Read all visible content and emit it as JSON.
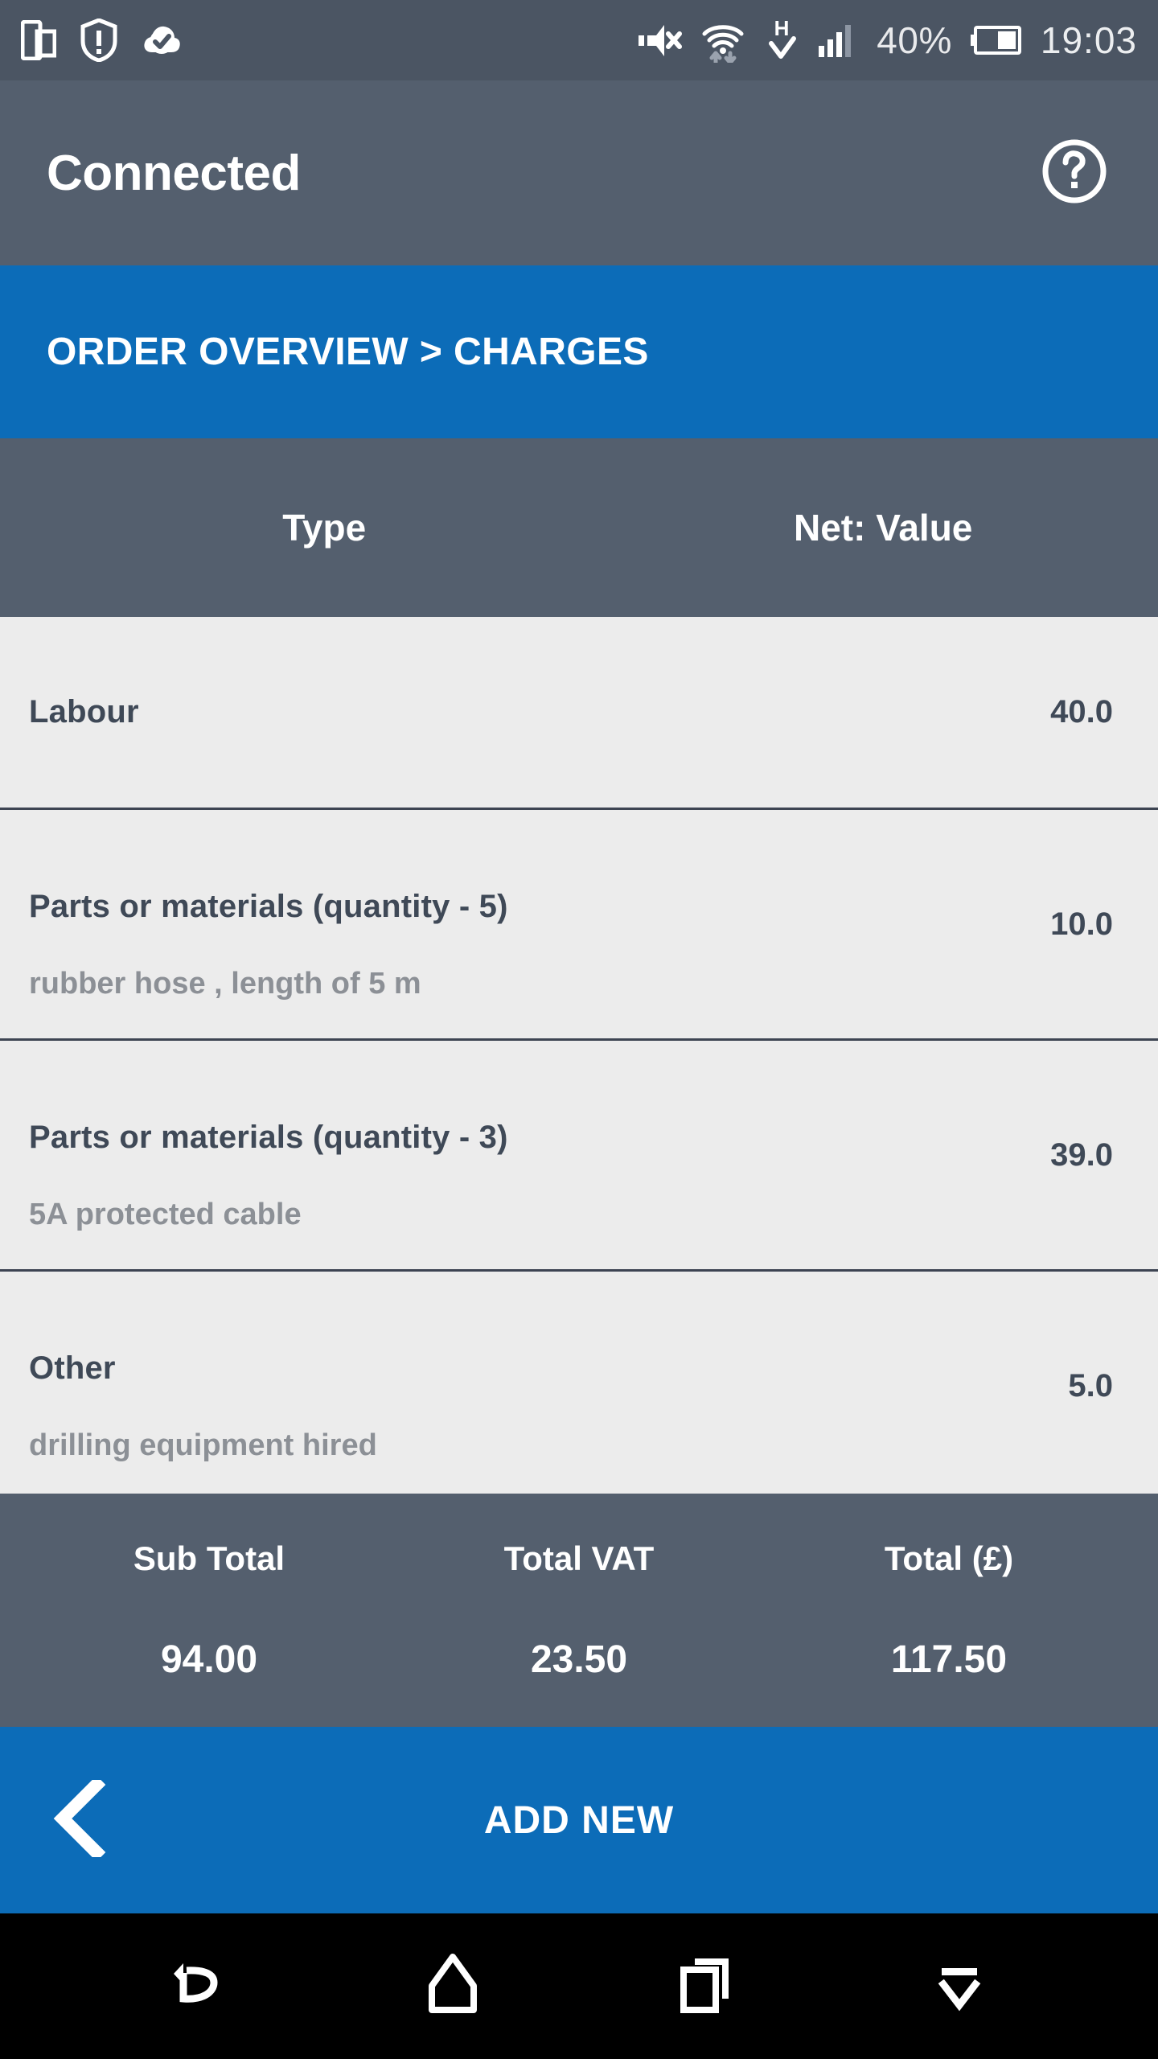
{
  "status_bar": {
    "left_icons": [
      {
        "name": "screen-share-icon",
        "label": "screen share"
      },
      {
        "name": "shield-warning-icon",
        "label": "security warning"
      },
      {
        "name": "cloud-check-icon",
        "label": "sync complete"
      }
    ],
    "right_icons": [
      {
        "name": "volume-mute-icon",
        "label": "muted"
      },
      {
        "name": "wifi-transfer-icon",
        "label": "wifi data transfer"
      },
      {
        "name": "hspa-check-icon",
        "label": "H network connected"
      },
      {
        "name": "signal-bars-icon",
        "label": "cellular signal"
      }
    ],
    "battery_percent": "40%",
    "clock": "19:03"
  },
  "app_header": {
    "title": "Connected",
    "help_icon": "help-circle-icon"
  },
  "breadcrumb": {
    "text": "ORDER OVERVIEW > CHARGES"
  },
  "table": {
    "columns": [
      "Type",
      "Net: Value"
    ],
    "rows": [
      {
        "type": "Labour",
        "description": "",
        "value": "40.0"
      },
      {
        "type": "Parts or materials  (quantity - 5)",
        "description": "rubber hose , length of 5 m",
        "value": "10.0"
      },
      {
        "type": "Parts or materials  (quantity - 3)",
        "description": "5A protected cable",
        "value": "39.0"
      },
      {
        "type": "Other",
        "description": "drilling equipment hired",
        "value": "5.0"
      }
    ]
  },
  "totals": {
    "labels": [
      "Sub Total",
      "Total VAT",
      "Total (£)"
    ],
    "values": [
      "94.00",
      "23.50",
      "117.50"
    ]
  },
  "action_bar": {
    "back_icon": "chevron-left-icon",
    "add_new_label": "ADD NEW"
  },
  "nav_bar": {
    "buttons": [
      {
        "name": "nav-back-icon",
        "label": "Back"
      },
      {
        "name": "nav-home-icon",
        "label": "Home"
      },
      {
        "name": "nav-recents-icon",
        "label": "Recents"
      },
      {
        "name": "nav-hide-keyboard-icon",
        "label": "Hide"
      }
    ]
  },
  "colors": {
    "accent_blue": "#0c6cb8",
    "header_gray": "#545f6e",
    "status_gray": "#4b5563",
    "row_bg": "#ececec",
    "divider": "#3d4452",
    "muted_text": "#8c9096",
    "dark_text": "#3f4957"
  }
}
